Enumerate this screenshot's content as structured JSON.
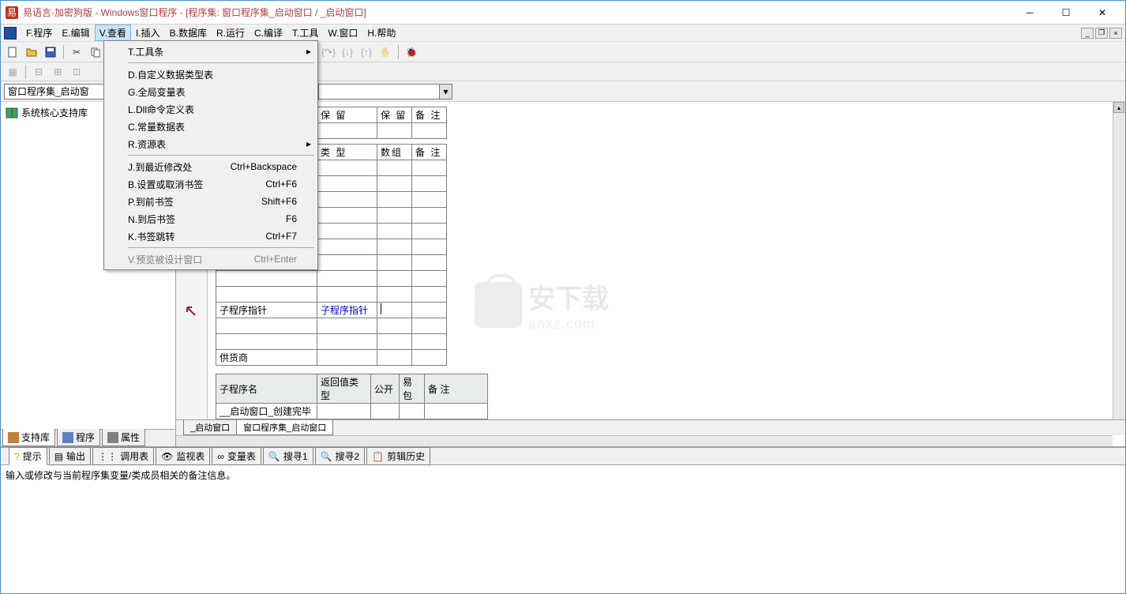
{
  "title": "易语言-加密狗版 - Windows窗口程序 - [程序集: 窗口程序集_启动窗口 / _启动窗口]",
  "menu": {
    "file": "F.程序",
    "edit": "E.编辑",
    "view": "V.查看",
    "insert": "I.插入",
    "database": "B.数据库",
    "run": "R.运行",
    "compile": "C.编译",
    "tools": "T.工具",
    "window": "W.窗口",
    "help": "H.帮助"
  },
  "dropdown": {
    "items": [
      {
        "label": "T.工具条",
        "arrow": true
      },
      {
        "sep": true
      },
      {
        "label": "D.自定义数据类型表"
      },
      {
        "label": "G.全局变量表"
      },
      {
        "label": "L.Dll命令定义表"
      },
      {
        "label": "C.常量数据表"
      },
      {
        "label": "R.资源表",
        "arrow": true
      },
      {
        "sep": true
      },
      {
        "label": "J.到最近修改处",
        "shortcut": "Ctrl+Backspace"
      },
      {
        "label": "B.设置或取消书签",
        "shortcut": "Ctrl+F6"
      },
      {
        "label": "P.到前书签",
        "shortcut": "Shift+F6"
      },
      {
        "label": "N.到后书签",
        "shortcut": "F6"
      },
      {
        "label": "K.书签跳转",
        "shortcut": "Ctrl+F7"
      },
      {
        "sep": true
      },
      {
        "label": "V.预览被设计窗口",
        "shortcut": "Ctrl+Enter",
        "disabled": true
      }
    ]
  },
  "combo": {
    "label": "窗口程序集_启动窗"
  },
  "tree": {
    "item1": "系统核心支持库"
  },
  "left_tabs": {
    "t1": "支持库",
    "t2": "程序",
    "t3": "属性"
  },
  "headers": {
    "baoliu1": "保 留",
    "baoliu2": "保 留",
    "beizhu": "备 注",
    "leixing": "类 型",
    "shuzu": "数组",
    "fanhui": "返回值类型",
    "gongkai": "公开",
    "yibao": "易包",
    "zichengxuming": "子程序名"
  },
  "rows": {
    "ptr_label": "子程序指针",
    "ptr_type": "子程序指针",
    "supplier": "供货商",
    "startup": "__启动窗口_创建完毕"
  },
  "editor_tabs": {
    "t1": "_启动窗口",
    "t2": "窗口程序集_启动窗口"
  },
  "bottom_tabs": {
    "t1": "提示",
    "t2": "输出",
    "t3": "调用表",
    "t4": "监视表",
    "t5": "变量表",
    "t6": "搜寻1",
    "t7": "搜寻2",
    "t8": "剪辑历史"
  },
  "bottom_msg": "输入或修改与当前程序集变量/类成员相关的备注信息。",
  "watermark": {
    "cn": "安下载",
    "en": "anxz.com"
  }
}
